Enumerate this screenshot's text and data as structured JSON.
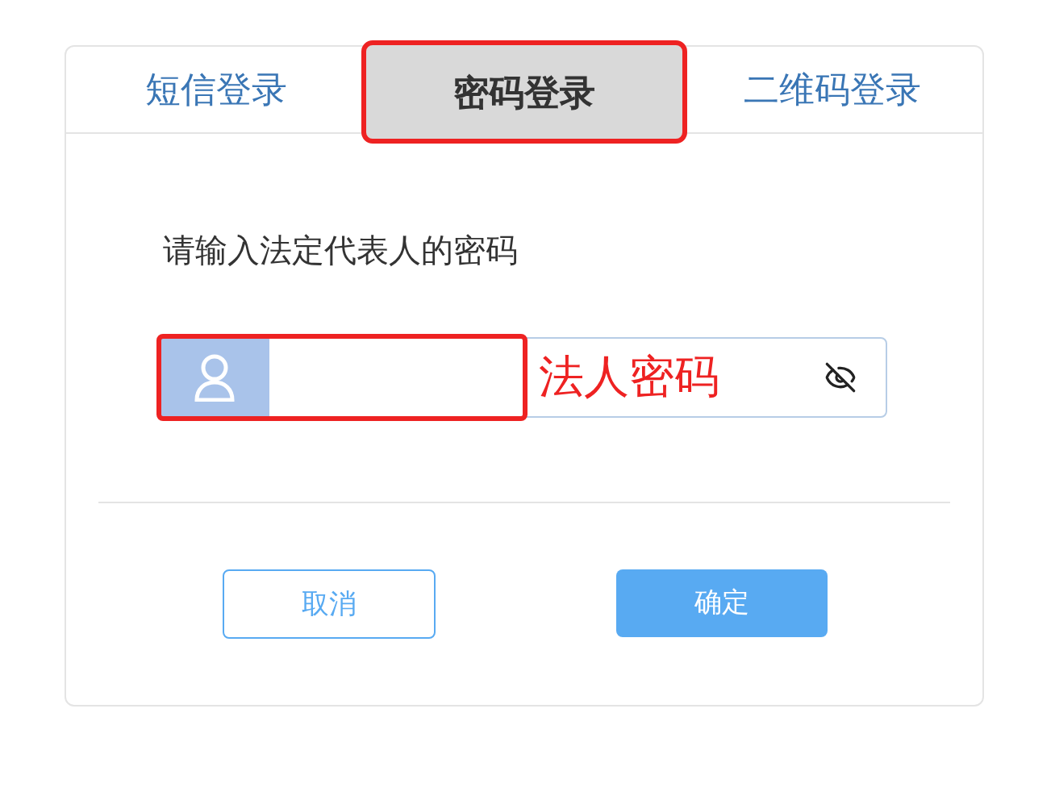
{
  "tabs": [
    {
      "label": "短信登录",
      "selected": false
    },
    {
      "label": "密码登录",
      "selected": true
    },
    {
      "label": "二维码登录",
      "selected": false
    }
  ],
  "prompt": "请输入法定代表人的密码",
  "password_field": {
    "annotation": "法人密码"
  },
  "buttons": [
    {
      "label": "取消",
      "kind": "secondary"
    },
    {
      "label": "确定",
      "kind": "primary"
    }
  ]
}
